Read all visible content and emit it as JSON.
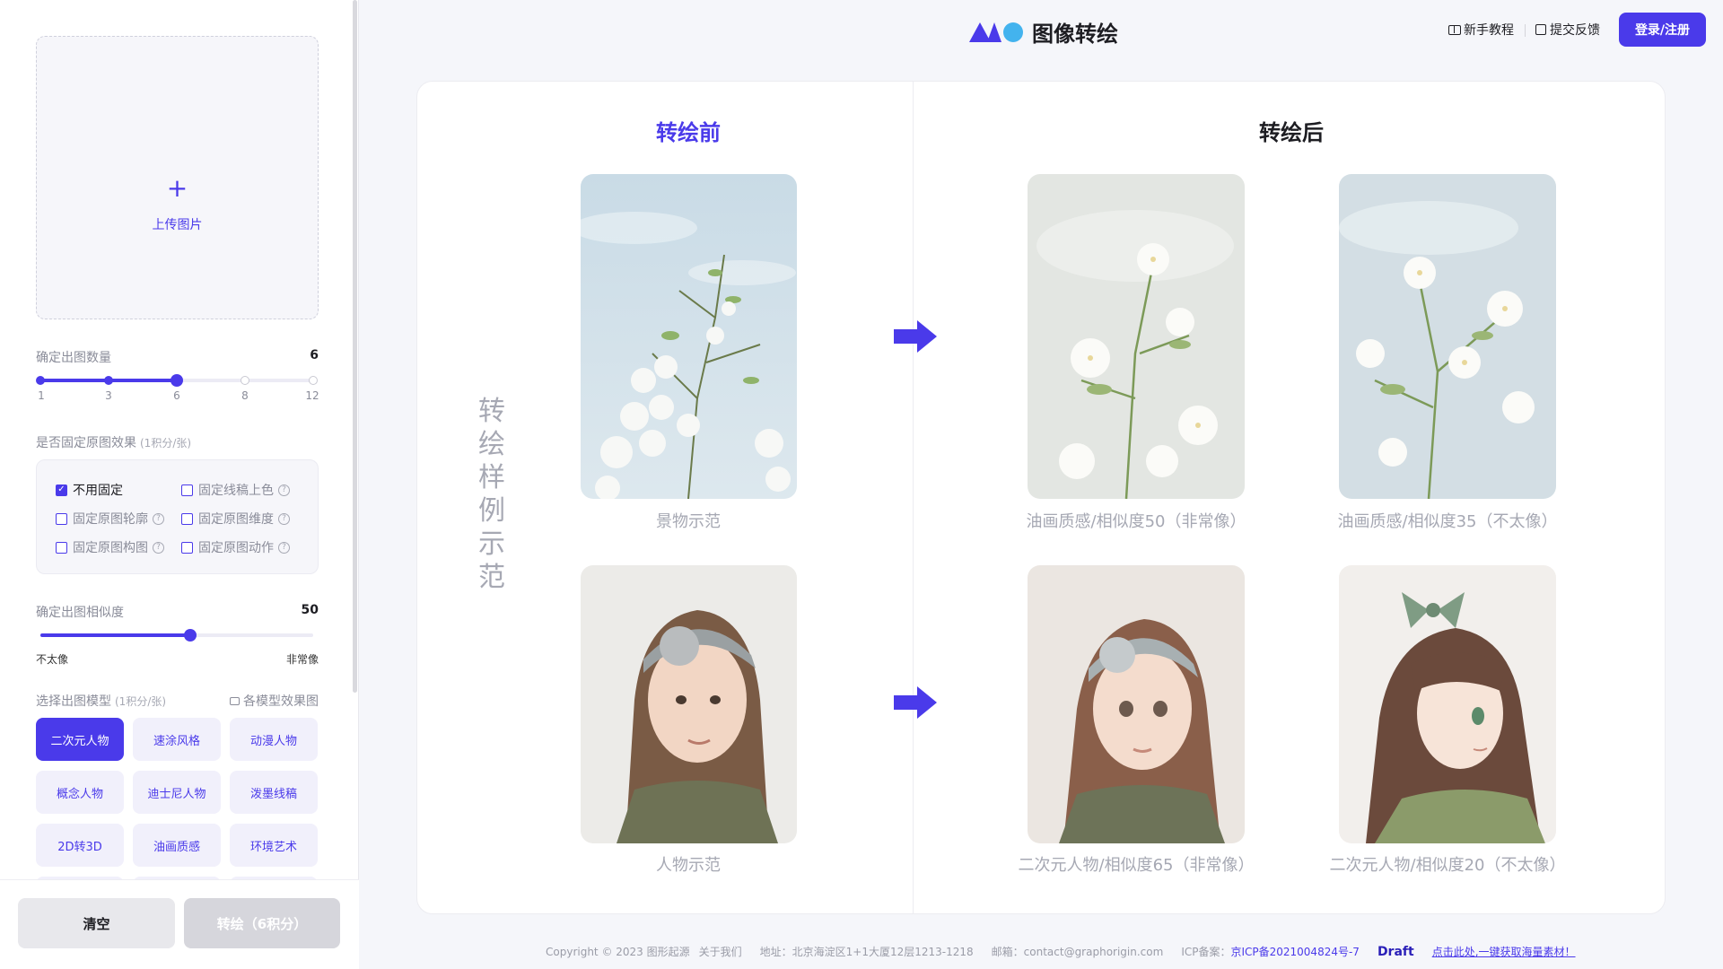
{
  "app": {
    "title": "图像转绘"
  },
  "header": {
    "tutorial_label": "新手教程",
    "feedback_label": "提交反馈",
    "login_label": "登录/注册"
  },
  "sidebar": {
    "upload_label": "上传图片",
    "upload_icon": "plus-icon",
    "count": {
      "label": "确定出图数量",
      "value": "6",
      "ticks": [
        "1",
        "3",
        "6",
        "8",
        "12"
      ],
      "selected_index": 2
    },
    "fix": {
      "label": "是否固定原图效果",
      "sub": "(1积分/张)",
      "options": [
        {
          "label": "不用固定",
          "checked": true,
          "help": false
        },
        {
          "label": "固定线稿上色",
          "checked": false,
          "help": true
        },
        {
          "label": "固定原图轮廓",
          "checked": false,
          "help": true
        },
        {
          "label": "固定原图维度",
          "checked": false,
          "help": true
        },
        {
          "label": "固定原图构图",
          "checked": false,
          "help": true
        },
        {
          "label": "固定原图动作",
          "checked": false,
          "help": true
        }
      ]
    },
    "similarity": {
      "label": "确定出图相似度",
      "value": "50",
      "level": 0.55,
      "min_label": "不太像",
      "max_label": "非常像"
    },
    "model": {
      "label": "选择出图模型",
      "sub": "(1积分/张)",
      "link_label": "各模型效果图",
      "buttons": [
        "二次元人物",
        "速涂风格",
        "动漫人物",
        "概念人物",
        "迪士尼人物",
        "泼墨线稿",
        "2D转3D",
        "油画质感",
        "环境艺术"
      ],
      "selected": "二次元人物"
    },
    "clear_label": "清空",
    "convert_label": "转绘（6积分）"
  },
  "main": {
    "before_title": "转绘前",
    "after_title": "转绘后",
    "vertical_title": [
      "转",
      "绘",
      "样",
      "例",
      "示",
      "范"
    ],
    "captions": {
      "landscape_src": "景物示范",
      "landscape_out1": "油画质感/相似度50（非常像）",
      "landscape_out2": "油画质感/相似度35（不太像）",
      "person_src": "人物示范",
      "person_out1": "二次元人物/相似度65（非常像）",
      "person_out2": "二次元人物/相似度20（不太像）"
    }
  },
  "footer": {
    "copyright": "Copyright © 2023 图形起源",
    "about": "关于我们",
    "address": "地址：北京海淀区1+1大厦12层1213-1218",
    "email": "邮箱：contact@graphorigin.com",
    "icp_label": "ICP备案：",
    "icp_no": "京ICP备2021004824号-7",
    "draft_brand": "Draft",
    "draft_link": "点击此处,一键获取海量素材！"
  },
  "colors": {
    "accent": "#4a3aea",
    "logo_blue": "#43b3ee",
    "muted_text": "#a6a8b3"
  }
}
